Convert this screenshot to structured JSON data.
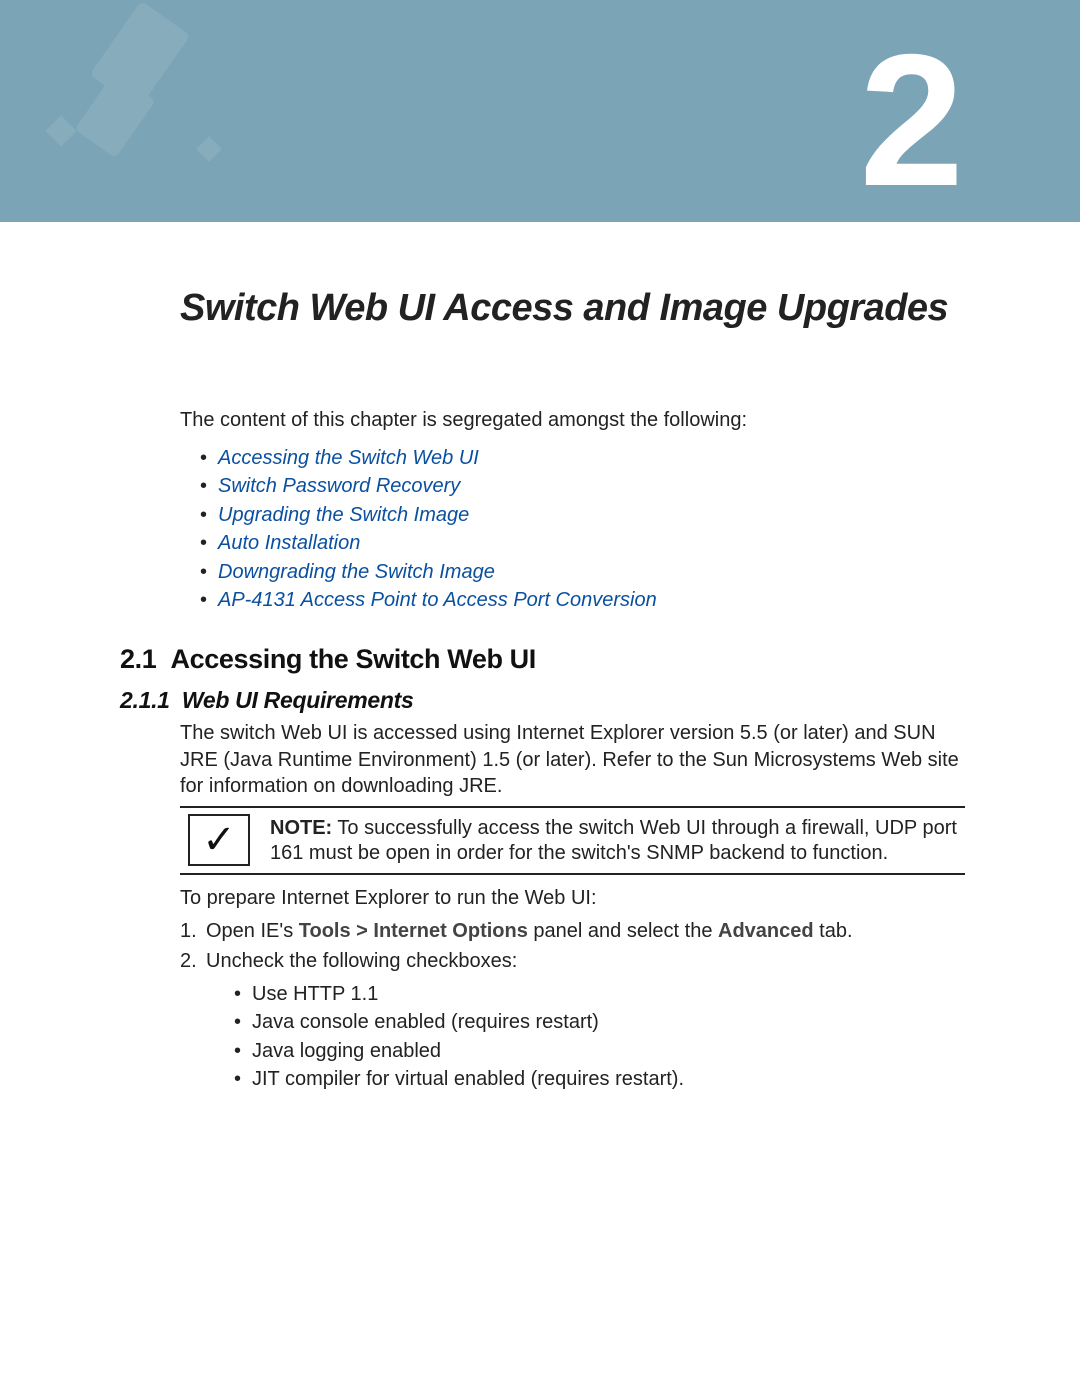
{
  "chapter": {
    "number": "2",
    "title": "Switch Web UI Access and Image Upgrades"
  },
  "intro": "The content of this chapter is segregated amongst the following:",
  "toc": [
    "Accessing the Switch Web UI",
    "Switch Password Recovery",
    "Upgrading the Switch Image",
    "Auto Installation",
    "Downgrading the Switch Image",
    "AP-4131 Access Point to Access Port Conversion"
  ],
  "section": {
    "number": "2.1",
    "title": "Accessing the Switch Web UI"
  },
  "subsection": {
    "number": "2.1.1",
    "title": "Web UI Requirements",
    "para": "The switch Web UI is accessed using Internet Explorer version 5.5 (or later) and SUN JRE (Java Runtime Environment) 1.5 (or later). Refer to the Sun Microsystems Web site for information on downloading JRE."
  },
  "note": {
    "label": "NOTE:",
    "text": "To successfully access the switch Web UI through a firewall, UDP port 161 must be open in order for the switch's SNMP backend to function."
  },
  "steps": {
    "lead": "To prepare Internet Explorer to run the Web UI:",
    "items": [
      {
        "pre": "Open IE's ",
        "bold1": "Tools > Internet Options",
        "mid": " panel and select the ",
        "bold2": "Advanced",
        "post": " tab."
      },
      {
        "text": "Uncheck the following checkboxes:",
        "sub": [
          "Use HTTP 1.1",
          "Java console enabled (requires restart)",
          "Java logging enabled",
          "JIT compiler for virtual enabled (requires restart)."
        ]
      }
    ]
  }
}
